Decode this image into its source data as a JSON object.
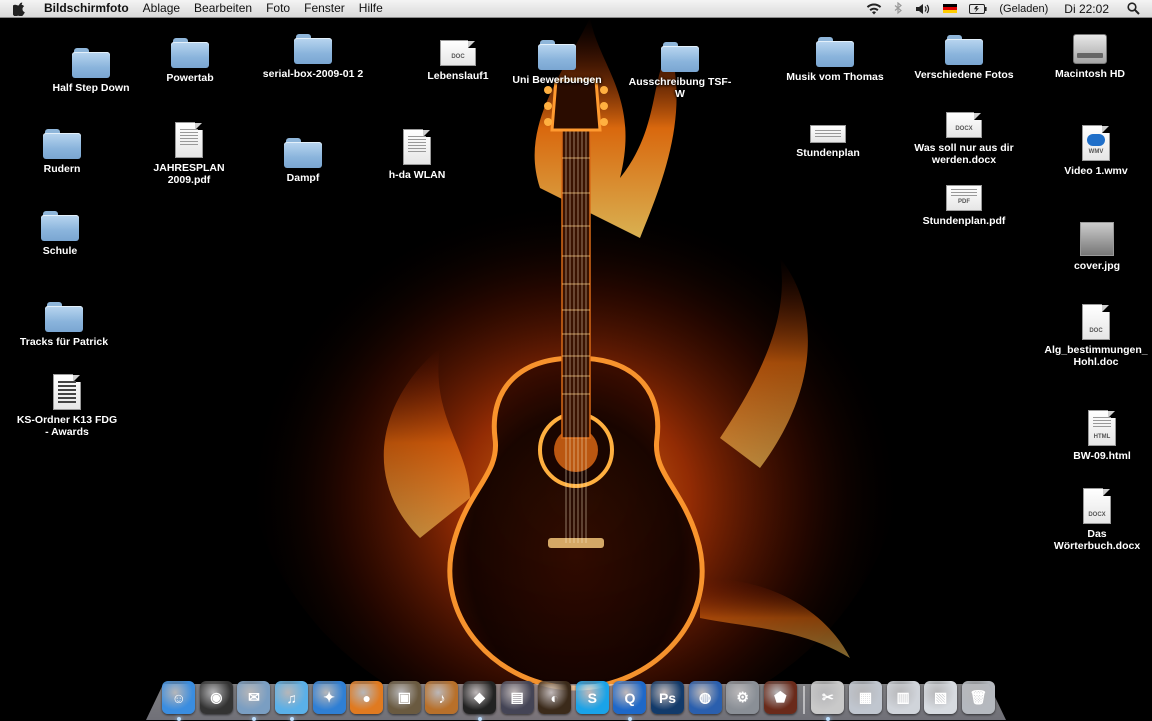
{
  "menubar": {
    "apple_icon": "apple-icon",
    "app_name": "Bildschirmfoto",
    "menus": [
      "Ablage",
      "Bearbeiten",
      "Foto",
      "Fenster",
      "Hilfe"
    ],
    "status": {
      "battery_text": "(Geladen)",
      "clock": "Di 22:02",
      "icons": [
        "wifi-icon",
        "bluetooth-icon",
        "volume-icon",
        "german-flag-icon",
        "battery-icon",
        "spotlight-icon"
      ]
    }
  },
  "desktop": {
    "wallpaper": "flaming-acoustic-guitar",
    "icons": [
      {
        "label": "Half Step Down",
        "kind": "folder"
      },
      {
        "label": "Powertab",
        "kind": "folder"
      },
      {
        "label": "serial-box-2009-01 2",
        "kind": "folder"
      },
      {
        "label": "Lebenslauf1",
        "kind": "doc",
        "tag": "DOC"
      },
      {
        "label": "Uni Bewerbungen",
        "kind": "folder"
      },
      {
        "label": "Ausschreibung TSF-W",
        "kind": "folder"
      },
      {
        "label": "Musik vom Thomas",
        "kind": "folder"
      },
      {
        "label": "Verschiedene Fotos",
        "kind": "folder"
      },
      {
        "label": "Macintosh HD",
        "kind": "harddisk"
      },
      {
        "label": "Rudern",
        "kind": "folder"
      },
      {
        "label": "JAHRESPLAN 2009.pdf",
        "kind": "doc",
        "tag": ""
      },
      {
        "label": "Dampf",
        "kind": "folder"
      },
      {
        "label": "h-da WLAN",
        "kind": "doc",
        "tag": ""
      },
      {
        "label": "Stundenplan",
        "kind": "doc",
        "tag": ""
      },
      {
        "label": "Was soll nur aus dir werden.docx",
        "kind": "doc",
        "tag": "DOCX"
      },
      {
        "label": "Video 1.wmv",
        "kind": "doc",
        "tag": "WMV"
      },
      {
        "label": "Schule",
        "kind": "folder"
      },
      {
        "label": "Stundenplan.pdf",
        "kind": "doc",
        "tag": "PDF"
      },
      {
        "label": "cover.jpg",
        "kind": "image"
      },
      {
        "label": "Tracks für Patrick",
        "kind": "folder"
      },
      {
        "label": "Alg_bestimmungen_Hohl.doc",
        "kind": "doc",
        "tag": "DOC"
      },
      {
        "label": "KS-Ordner K13 FDG - Awards",
        "kind": "doc",
        "tag": ""
      },
      {
        "label": "BW-09.html",
        "kind": "doc",
        "tag": "HTML"
      },
      {
        "label": "Das Wörterbuch.docx",
        "kind": "doc",
        "tag": "DOCX"
      }
    ]
  },
  "dock": {
    "apps": [
      {
        "icon": "finder-icon",
        "glyph": "☺",
        "color": "#3a8de0",
        "running": true
      },
      {
        "icon": "dashboard-icon",
        "glyph": "◉",
        "color": "#333",
        "running": false
      },
      {
        "icon": "mail-icon",
        "glyph": "✉",
        "color": "#7a9ec2",
        "running": true
      },
      {
        "icon": "itunes-icon",
        "glyph": "♫",
        "color": "#5ab0e8",
        "running": true
      },
      {
        "icon": "safari-icon",
        "glyph": "✦",
        "color": "#2f7fd4",
        "running": false
      },
      {
        "icon": "firefox-icon",
        "glyph": "●",
        "color": "#e07a20",
        "running": false
      },
      {
        "icon": "iphoto-icon",
        "glyph": "▣",
        "color": "#6a5a40",
        "running": false
      },
      {
        "icon": "garageband-icon",
        "glyph": "♪",
        "color": "#b8702a",
        "running": false
      },
      {
        "icon": "adium-icon",
        "glyph": "◆",
        "color": "#222",
        "running": true
      },
      {
        "icon": "preview-icon",
        "glyph": "▤",
        "color": "#445",
        "running": false
      },
      {
        "icon": "monkey-icon",
        "glyph": "◐",
        "color": "#3b2a1a",
        "running": false
      },
      {
        "icon": "skype-icon",
        "glyph": "S",
        "color": "#1aa3e8",
        "running": false
      },
      {
        "icon": "quicktime-icon",
        "glyph": "Q",
        "color": "#1e68c8",
        "running": true
      },
      {
        "icon": "photoshop-icon",
        "glyph": "Ps",
        "color": "#123a6a",
        "running": false
      },
      {
        "icon": "google-earth-icon",
        "glyph": "◍",
        "color": "#2a5fae",
        "running": false
      },
      {
        "icon": "system-preferences-icon",
        "glyph": "⚙",
        "color": "#8a8f96",
        "running": false
      },
      {
        "icon": "shield-icon",
        "glyph": "⬟",
        "color": "#6a2a1a",
        "running": false
      },
      {
        "icon": "utility-icon",
        "glyph": "✂",
        "color": "#c9c9c9",
        "running": true
      },
      {
        "icon": "documents-stack-icon",
        "glyph": "▦",
        "color": "#c0c6cf",
        "running": false
      },
      {
        "icon": "downloads-stack-icon",
        "glyph": "▥",
        "color": "#d0d4da",
        "running": false
      },
      {
        "icon": "applications-stack-icon",
        "glyph": "▧",
        "color": "#d7dbe0",
        "running": false
      },
      {
        "icon": "trash-icon",
        "glyph": "🗑",
        "color": "#b5b9bf",
        "running": false
      }
    ]
  }
}
